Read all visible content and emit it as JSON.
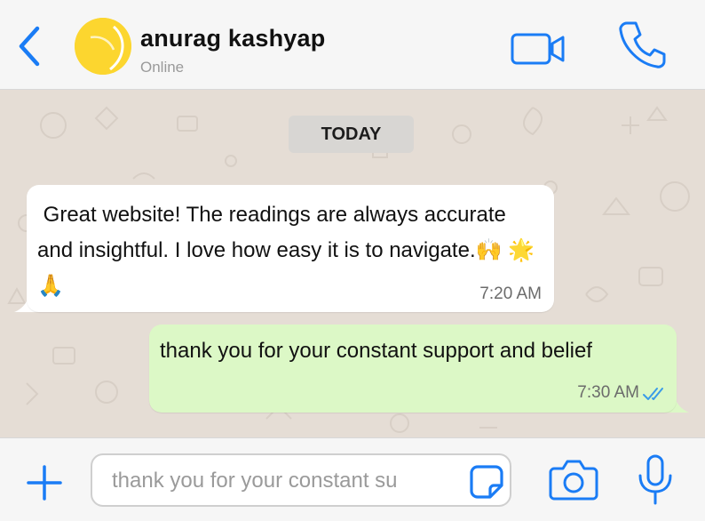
{
  "header": {
    "contact_name": "anurag kashyap",
    "status": "Online",
    "back_icon": "chevron-left-icon",
    "video_icon": "video-camera-icon",
    "call_icon": "phone-icon"
  },
  "chat": {
    "date_separator": "TODAY",
    "messages": [
      {
        "direction": "incoming",
        "text": " Great website! The readings are always accurate and insightful. I love how easy it is to navigate.🙌 🌟🙏",
        "time": "7:20 AM"
      },
      {
        "direction": "outgoing",
        "text": "thank you for your constant support and belief",
        "time": "7:30 AM",
        "status_icon": "double-check-icon"
      }
    ]
  },
  "composer": {
    "input_value": "thank you for your constant su",
    "plus_icon": "plus-icon",
    "sticker_icon": "sticker-icon",
    "camera_icon": "camera-icon",
    "mic_icon": "microphone-icon"
  },
  "colors": {
    "accent": "#1a7cf5",
    "header_bg": "#f6f6f6",
    "chat_bg": "#e5ddd5",
    "incoming_bubble": "#ffffff",
    "outgoing_bubble": "#dcf8c6",
    "avatar": "#fcd62f",
    "read_ticks": "#3a9be8"
  }
}
